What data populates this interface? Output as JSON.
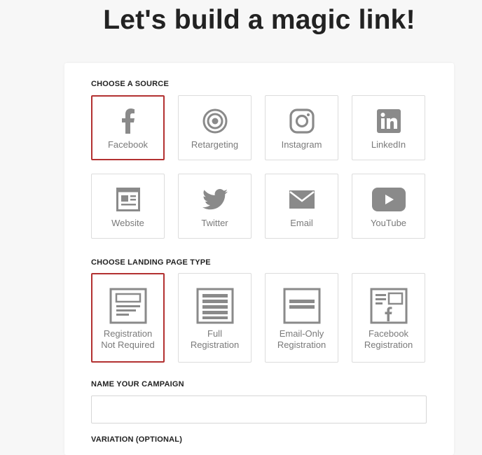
{
  "page": {
    "title": "Let's build a magic link!"
  },
  "sections": {
    "source_label": "CHOOSE A SOURCE",
    "landing_label": "CHOOSE LANDING PAGE TYPE",
    "campaign_label": "NAME YOUR CAMPAIGN",
    "variation_label": "VARIATION (OPTIONAL)"
  },
  "sources": [
    {
      "label": "Facebook",
      "icon": "facebook-icon",
      "selected": true
    },
    {
      "label": "Retargeting",
      "icon": "target-icon",
      "selected": false
    },
    {
      "label": "Instagram",
      "icon": "instagram-icon",
      "selected": false
    },
    {
      "label": "LinkedIn",
      "icon": "linkedin-icon",
      "selected": false
    },
    {
      "label": "Website",
      "icon": "website-icon",
      "selected": false
    },
    {
      "label": "Twitter",
      "icon": "twitter-icon",
      "selected": false
    },
    {
      "label": "Email",
      "icon": "email-icon",
      "selected": false
    },
    {
      "label": "YouTube",
      "icon": "youtube-icon",
      "selected": false
    }
  ],
  "landing_types": [
    {
      "line1": "Registration",
      "line2": "Not Required",
      "icon": "registration-not-required-icon",
      "selected": true
    },
    {
      "line1": "Full",
      "line2": "Registration",
      "icon": "full-registration-icon",
      "selected": false
    },
    {
      "line1": "Email-Only",
      "line2": "Registration",
      "icon": "email-only-registration-icon",
      "selected": false
    },
    {
      "line1": "Facebook",
      "line2": "Registration",
      "icon": "facebook-registration-icon",
      "selected": false
    }
  ],
  "campaign": {
    "value": "",
    "placeholder": ""
  },
  "colors": {
    "selected_border": "#b33131",
    "icon_gray": "#8a8a8a",
    "label_gray": "#7a7a7a"
  }
}
